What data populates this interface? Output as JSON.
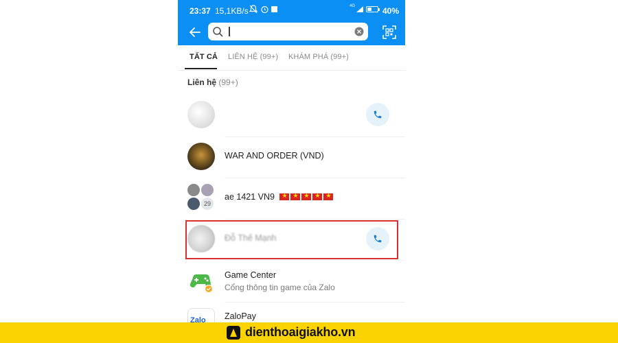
{
  "status_bar": {
    "time": "23:37",
    "speed": "15,1KB/s",
    "network": "4G",
    "battery": "40%",
    "battery_level": 0.4
  },
  "search": {
    "placeholder": "",
    "value": ""
  },
  "tabs": [
    {
      "label": "TẤT CẢ",
      "active": true
    },
    {
      "label": "LIÊN HỆ (99+)",
      "active": false
    },
    {
      "label": "KHÁM PHÁ (99+)",
      "active": false
    }
  ],
  "section": {
    "label": "Liên hệ",
    "count": "(99+)"
  },
  "contacts": [
    {
      "name": "",
      "has_call": true
    },
    {
      "name": "WAR AND ORDER (VND)",
      "has_call": false
    },
    {
      "name": "ae 1421 VN9",
      "member_count": "29",
      "flags": 5,
      "has_call": false
    },
    {
      "name": "Đỗ Thế Mạnh",
      "has_call": true
    },
    {
      "name": "Game Center",
      "subtitle": "Cổng thông tin game của Zalo",
      "has_call": false
    },
    {
      "name": "ZaloPay",
      "logo_text": "Zalo",
      "has_call": false
    }
  ],
  "footer": {
    "site": "dienthoaigiakho.vn"
  },
  "colors": {
    "brand_blue": "#0b8ff5",
    "highlight_red": "#d9322e",
    "footer_yellow": "#fbd400"
  }
}
